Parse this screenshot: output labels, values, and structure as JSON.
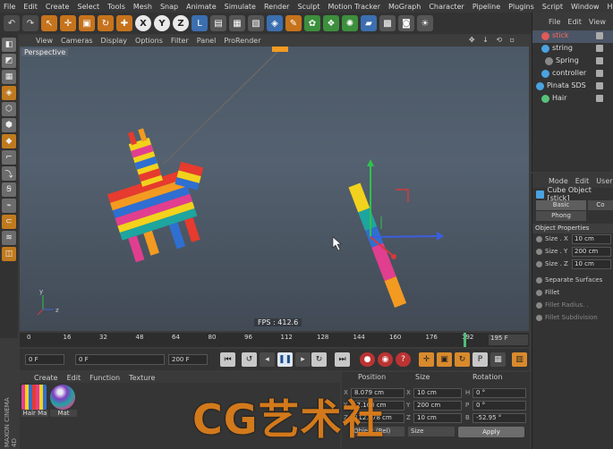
{
  "menu": [
    "File",
    "Edit",
    "Create",
    "Select",
    "Tools",
    "Mesh",
    "Snap",
    "Animate",
    "Simulate",
    "Render",
    "Sculpt",
    "Motion Tracker",
    "MoGraph",
    "Character",
    "Pipeline",
    "Plugins",
    "Script",
    "Window",
    "Help"
  ],
  "toolbar": {
    "undo": "↶",
    "redo": "↷",
    "select": "↖",
    "move": "✛",
    "scale": "▣",
    "rotate": "↻",
    "add": "✚",
    "x_axis": "X",
    "y_axis": "Y",
    "z_axis": "Z",
    "coord": "L"
  },
  "viewport": {
    "menu": [
      "View",
      "Cameras",
      "Display",
      "Options",
      "Filter",
      "Panel",
      "ProRender"
    ],
    "controls": "✥ ↓ ⟲ ▫",
    "label": "Perspective",
    "fps": "FPS : 412.6",
    "colors": {
      "red": "#e63b2e",
      "orange": "#f39a21",
      "yellow": "#f2d21c",
      "blue": "#2f6fd1",
      "pink": "#e23e8f",
      "teal": "#1ea5a0",
      "purple": "#7a3fbf"
    }
  },
  "timeline": {
    "ticks": [
      "0",
      "16",
      "32",
      "48",
      "64",
      "80",
      "96",
      "112",
      "128",
      "144",
      "160",
      "176",
      "192"
    ],
    "end_frame": "195 F"
  },
  "transport": {
    "start": "0 F",
    "current": "0 F",
    "end": "200 F",
    "end2": "200 F"
  },
  "materials": {
    "menu": [
      "Create",
      "Edit",
      "Function",
      "Texture"
    ],
    "items": [
      {
        "name": "Hair Ma"
      },
      {
        "name": "Mat"
      }
    ]
  },
  "coordinates": {
    "headers": {
      "position": "Position",
      "size": "Size",
      "rotation": "Rotation"
    },
    "rows": [
      {
        "axis_p": "X",
        "pos": "8.079 cm",
        "axis_s": "X",
        "size": "10 cm",
        "axis_r": "H",
        "rot": "0 °"
      },
      {
        "axis_p": "Y",
        "pos": "-7.168 cm",
        "axis_s": "Y",
        "size": "200 cm",
        "axis_r": "P",
        "rot": "0 °"
      },
      {
        "axis_p": "Z",
        "pos": "112.878 cm",
        "axis_s": "Z",
        "size": "10 cm",
        "axis_r": "B",
        "rot": "-52.95 °"
      }
    ],
    "mode": "Object (Rel)",
    "size_mode": "Size",
    "apply": "Apply"
  },
  "objects": {
    "menu": [
      "File",
      "Edit",
      "View"
    ],
    "items": [
      {
        "name": "stick",
        "color": "#e05a5a",
        "selected": true
      },
      {
        "name": "string",
        "color": "#4aa3e0",
        "selected": false
      },
      {
        "name": "Spring",
        "color": "#888888",
        "selected": false
      },
      {
        "name": "controller",
        "color": "#4aa3e0",
        "selected": false
      },
      {
        "name": "Pinata SDS",
        "color": "#4aa3e0",
        "selected": false
      },
      {
        "name": "Hair",
        "color": "#58c27a",
        "selected": false
      }
    ]
  },
  "attributes": {
    "menu": [
      "Mode",
      "Edit",
      "User"
    ],
    "title": "Cube Object [stick]",
    "tabs": [
      "Basic",
      "Co",
      "Phong"
    ],
    "section": "Object Properties",
    "size_x_label": "Size . X",
    "size_x": "10 cm",
    "size_y_label": "Size . Y",
    "size_y": "200 cm",
    "size_z_label": "Size . Z",
    "size_z": "10 cm",
    "separate_surfaces": "Separate Surfaces",
    "fillet": "Fillet",
    "fillet_radius": "Fillet Radius. .",
    "fillet_subdivision": "Fillet Subdivision"
  },
  "branding": {
    "watermark": "CG艺术社",
    "vendor": "MAXON CINEMA 4D"
  }
}
